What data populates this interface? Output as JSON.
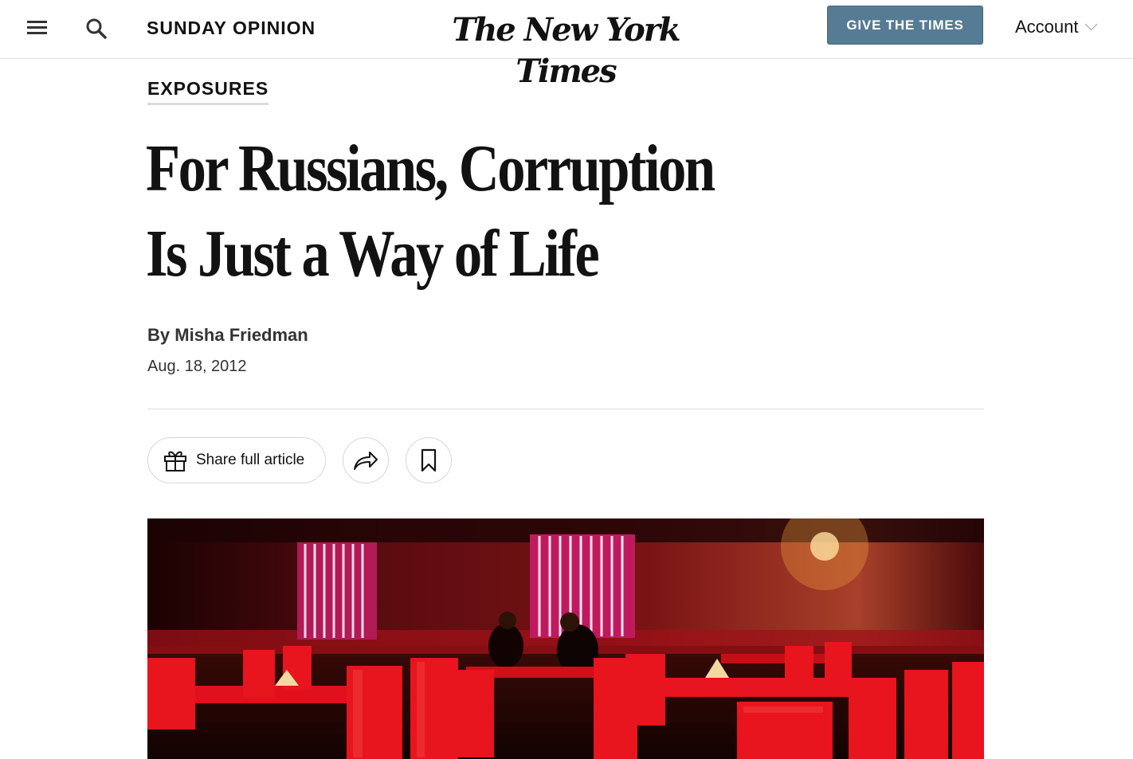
{
  "header": {
    "menu_icon": "hamburger-menu-icon",
    "search_icon": "search-icon",
    "section": "SUNDAY OPINION",
    "logo": "The New York Times",
    "give_button": "GIVE THE TIMES",
    "account": "Account",
    "account_icon": "chevron-down-icon",
    "give_button_color": "#567b95"
  },
  "article": {
    "kicker": "EXPOSURES",
    "headline_line1": "For Russians, Corruption",
    "headline_line2": "Is Just a Way of Life",
    "byline_prefix": "By",
    "author": "Misha Friedman",
    "date": "Aug. 18, 2012"
  },
  "actions": {
    "gift_icon": "gift-icon",
    "share_full_article": "Share full article",
    "share_icon": "share-arrow-icon",
    "bookmark_icon": "bookmark-icon"
  },
  "photo": {
    "dominant_colors": [
      "#c0141a",
      "#5a0a10",
      "#e8406a"
    ]
  }
}
